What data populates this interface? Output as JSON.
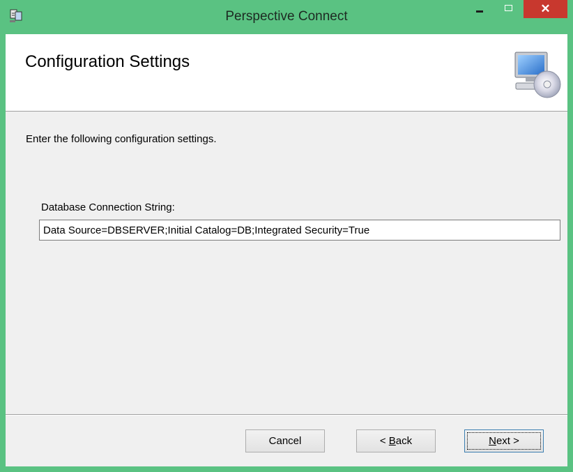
{
  "window": {
    "title": "Perspective Connect",
    "close_glyph": "✕",
    "colors": {
      "titlebar": "#5ac282",
      "close": "#c8382e"
    }
  },
  "header": {
    "title": "Configuration Settings",
    "icon": "computer-disc-icon"
  },
  "main": {
    "instructions": "Enter the following configuration settings.",
    "connection_label": "Database Connection String:",
    "connection_value": "Data Source=DBSERVER;Initial Catalog=DB;Integrated Security=True"
  },
  "buttons": {
    "cancel": "Cancel",
    "back_arrow": "< ",
    "back_mnemonic": "B",
    "back_rest": "ack",
    "next_mnemonic": "N",
    "next_rest": "ext >"
  }
}
